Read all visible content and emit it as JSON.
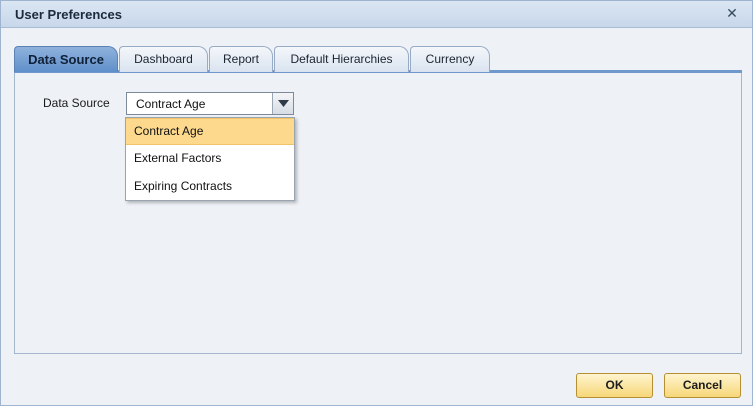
{
  "dialog": {
    "title": "User Preferences",
    "close_icon": "close-icon",
    "close_glyph": "✕"
  },
  "tabs": [
    {
      "label": "Data Source",
      "active": true
    },
    {
      "label": "Dashboard",
      "active": false
    },
    {
      "label": "Report",
      "active": false
    },
    {
      "label": "Default Hierarchies",
      "active": false
    },
    {
      "label": "Currency",
      "active": false
    }
  ],
  "form": {
    "data_source_label": "Data Source",
    "data_source_value": "Contract Age",
    "dropdown_icon": "chevron-down-icon",
    "options": [
      "Contract Age",
      "External Factors",
      "Expiring Contracts"
    ],
    "selected_option": "Contract Age"
  },
  "buttons": {
    "ok": "OK",
    "cancel": "Cancel"
  },
  "colors": {
    "active_tab": "#6f98cc",
    "highlight": "#fcd98c",
    "button": "#f6d778"
  }
}
